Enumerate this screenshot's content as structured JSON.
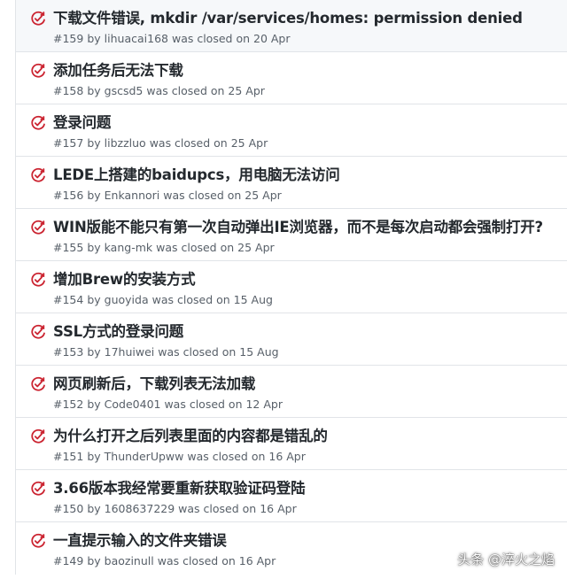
{
  "colors": {
    "closed_icon": "#cb2431",
    "title_text": "#24292e",
    "meta_text": "#586069",
    "border": "#e1e4e8"
  },
  "issues": [
    {
      "title": "下载文件错误, mkdir /var/services/homes: permission denied",
      "number": "#159",
      "by": "by",
      "author": "lihuacai168",
      "closed_text": "was closed on",
      "date": "20 Apr",
      "icon": "issue-closed-icon"
    },
    {
      "title": "添加任务后无法下载",
      "number": "#158",
      "by": "by",
      "author": "gscsd5",
      "closed_text": "was closed on",
      "date": "25 Apr",
      "icon": "issue-closed-icon"
    },
    {
      "title": "登录问题",
      "number": "#157",
      "by": "by",
      "author": "libzzluo",
      "closed_text": "was closed on",
      "date": "25 Apr",
      "icon": "issue-closed-icon"
    },
    {
      "title": "LEDE上搭建的baidupcs，用电脑无法访问",
      "number": "#156",
      "by": "by",
      "author": "Enkannori",
      "closed_text": "was closed on",
      "date": "25 Apr",
      "icon": "issue-closed-icon"
    },
    {
      "title": "WIN版能不能只有第一次自动弹出IE浏览器，而不是每次启动都会强制打开?",
      "number": "#155",
      "by": "by",
      "author": "kang-mk",
      "closed_text": "was closed on",
      "date": "25 Apr",
      "icon": "issue-closed-icon"
    },
    {
      "title": "增加Brew的安装方式",
      "number": "#154",
      "by": "by",
      "author": "guoyida",
      "closed_text": "was closed on",
      "date": "15 Aug",
      "icon": "issue-closed-icon"
    },
    {
      "title": "SSL方式的登录问题",
      "number": "#153",
      "by": "by",
      "author": "17huiwei",
      "closed_text": "was closed on",
      "date": "15 Aug",
      "icon": "issue-closed-icon"
    },
    {
      "title": "网页刷新后，下载列表无法加载",
      "number": "#152",
      "by": "by",
      "author": "Code0401",
      "closed_text": "was closed on",
      "date": "12 Apr",
      "icon": "issue-closed-icon"
    },
    {
      "title": "为什么打开之后列表里面的内容都是错乱的",
      "number": "#151",
      "by": "by",
      "author": "ThunderUpww",
      "closed_text": "was closed on",
      "date": "16 Apr",
      "icon": "issue-closed-icon"
    },
    {
      "title": "3.66版本我经常要重新获取验证码登陆",
      "number": "#150",
      "by": "by",
      "author": "1608637229",
      "closed_text": "was closed on",
      "date": "16 Apr",
      "icon": "issue-closed-icon"
    },
    {
      "title": "一直提示输入的文件夹错误",
      "number": "#149",
      "by": "by",
      "author": "baozinull",
      "closed_text": "was closed on",
      "date": "16 Apr",
      "icon": "issue-closed-icon"
    }
  ],
  "watermark": "头条 @淬火之焰"
}
